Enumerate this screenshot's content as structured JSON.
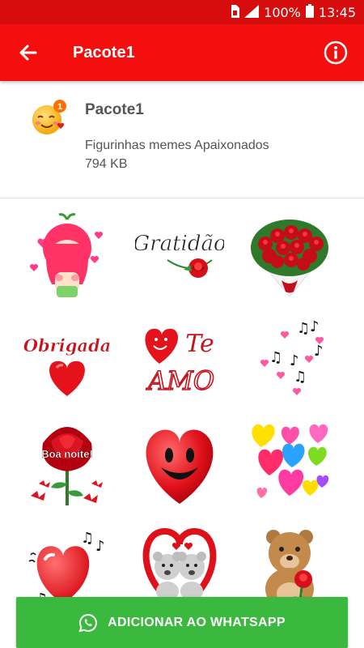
{
  "status_bar": {
    "battery": "100%",
    "time": "13:45"
  },
  "app_bar": {
    "title": "Pacote1"
  },
  "pack": {
    "name": "Pacote1",
    "publisher": "Figurinhas memes Apaixonados",
    "size": "794 KB",
    "tray_badge": "1"
  },
  "stickers": [
    {
      "name": "strawberry-girl-sticker"
    },
    {
      "name": "gratidao-sticker",
      "text": "Gratidão"
    },
    {
      "name": "rose-bouquet-sticker"
    },
    {
      "name": "obrigada-heart-sticker",
      "text": "Obrigada"
    },
    {
      "name": "te-amo-sticker",
      "text1": "Te",
      "text2": "AMO"
    },
    {
      "name": "music-hearts-sticker"
    },
    {
      "name": "boa-noite-rose-sticker",
      "text": "Boa noite!"
    },
    {
      "name": "smiling-heart-sticker"
    },
    {
      "name": "colorful-hearts-sticker"
    },
    {
      "name": "singing-heart-sticker"
    },
    {
      "name": "teddy-couple-sticker"
    },
    {
      "name": "teddy-bear-rose-sticker"
    }
  ],
  "add_button": {
    "label": "ADICIONAR AO WHATSAPP"
  },
  "colors": {
    "appbar": "#f40e0e",
    "statusbar": "#d60d0d",
    "button": "#3bb83e"
  }
}
